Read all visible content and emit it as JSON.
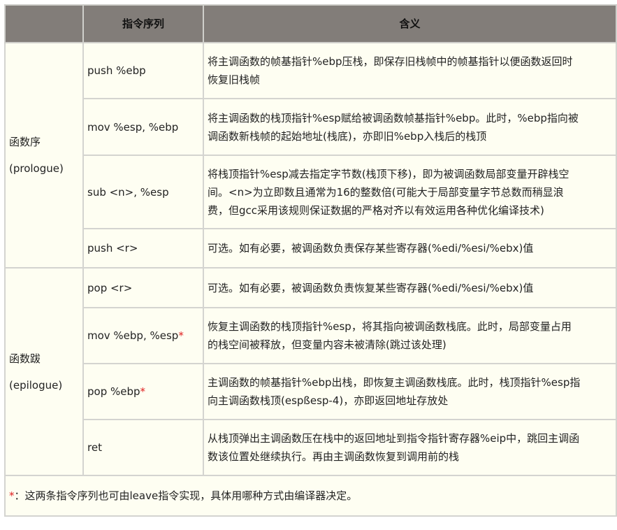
{
  "header": {
    "col1": "",
    "col2": "指令序列",
    "col3": "含义"
  },
  "groups": [
    {
      "name": "函数序",
      "name_en": "(prologue)"
    },
    {
      "name": "函数跋",
      "name_en": "(epilogue)"
    }
  ],
  "rows": [
    {
      "instr": "push %ebp",
      "star": "",
      "desc": [
        "将主调函数的帧基指针%ebp压栈，即保存旧栈帧中的帧基指针以便函数返回时",
        "恢复旧栈帧"
      ]
    },
    {
      "instr": "mov %esp, %ebp",
      "star": "",
      "desc": [
        "将主调函数的栈顶指针%esp赋给被调函数帧基指针%ebp。此时，%ebp指向被",
        "调函数新栈帧的起始地址(栈底)，亦即旧%ebp入栈后的栈顶"
      ]
    },
    {
      "instr": "sub <n>, %esp",
      "star": "",
      "desc": [
        "将栈顶指针%esp减去指定字节数(栈顶下移)，即为被调函数局部变量开辟栈空",
        "间。<n>为立即数且通常为16的整数倍(可能大于局部变量字节总数而稍显浪",
        "费，但gcc采用该规则保证数据的严格对齐以有效运用各种优化编译技术)"
      ]
    },
    {
      "instr": "push <r>",
      "star": "",
      "desc": [
        "可选。如有必要，被调函数负责保存某些寄存器(%edi/%esi/%ebx)值"
      ]
    },
    {
      "instr": "pop <r>",
      "star": "",
      "desc": [
        "可选。如有必要，被调函数负责恢复某些寄存器(%edi/%esi/%ebx)值"
      ]
    },
    {
      "instr": "mov %ebp, %esp",
      "star": "*",
      "desc": [
        "恢复主调函数的栈顶指针%esp，将其指向被调函数栈底。此时，局部变量占用",
        "的栈空间被释放，但变量内容未被清除(跳过该处理)"
      ]
    },
    {
      "instr": "pop %ebp",
      "star": "*",
      "desc": [
        "主调函数的帧基指针%ebp出栈，即恢复主调函数栈底。此时，栈顶指针%esp指",
        "向主调函数栈顶(espßesp-4)，亦即返回地址存放处"
      ]
    },
    {
      "instr": "ret",
      "star": "",
      "desc": [
        "从栈顶弹出主调函数压在栈中的返回地址到指令指针寄存器%eip中，跳回主调函",
        "数该位置处继续执行。再由主调函数恢复到调用前的栈"
      ]
    }
  ],
  "footnote": {
    "star": "*",
    "text": "：这两条指令序列也可由leave指令实现，具体用哪种方式由编译器决定。"
  }
}
